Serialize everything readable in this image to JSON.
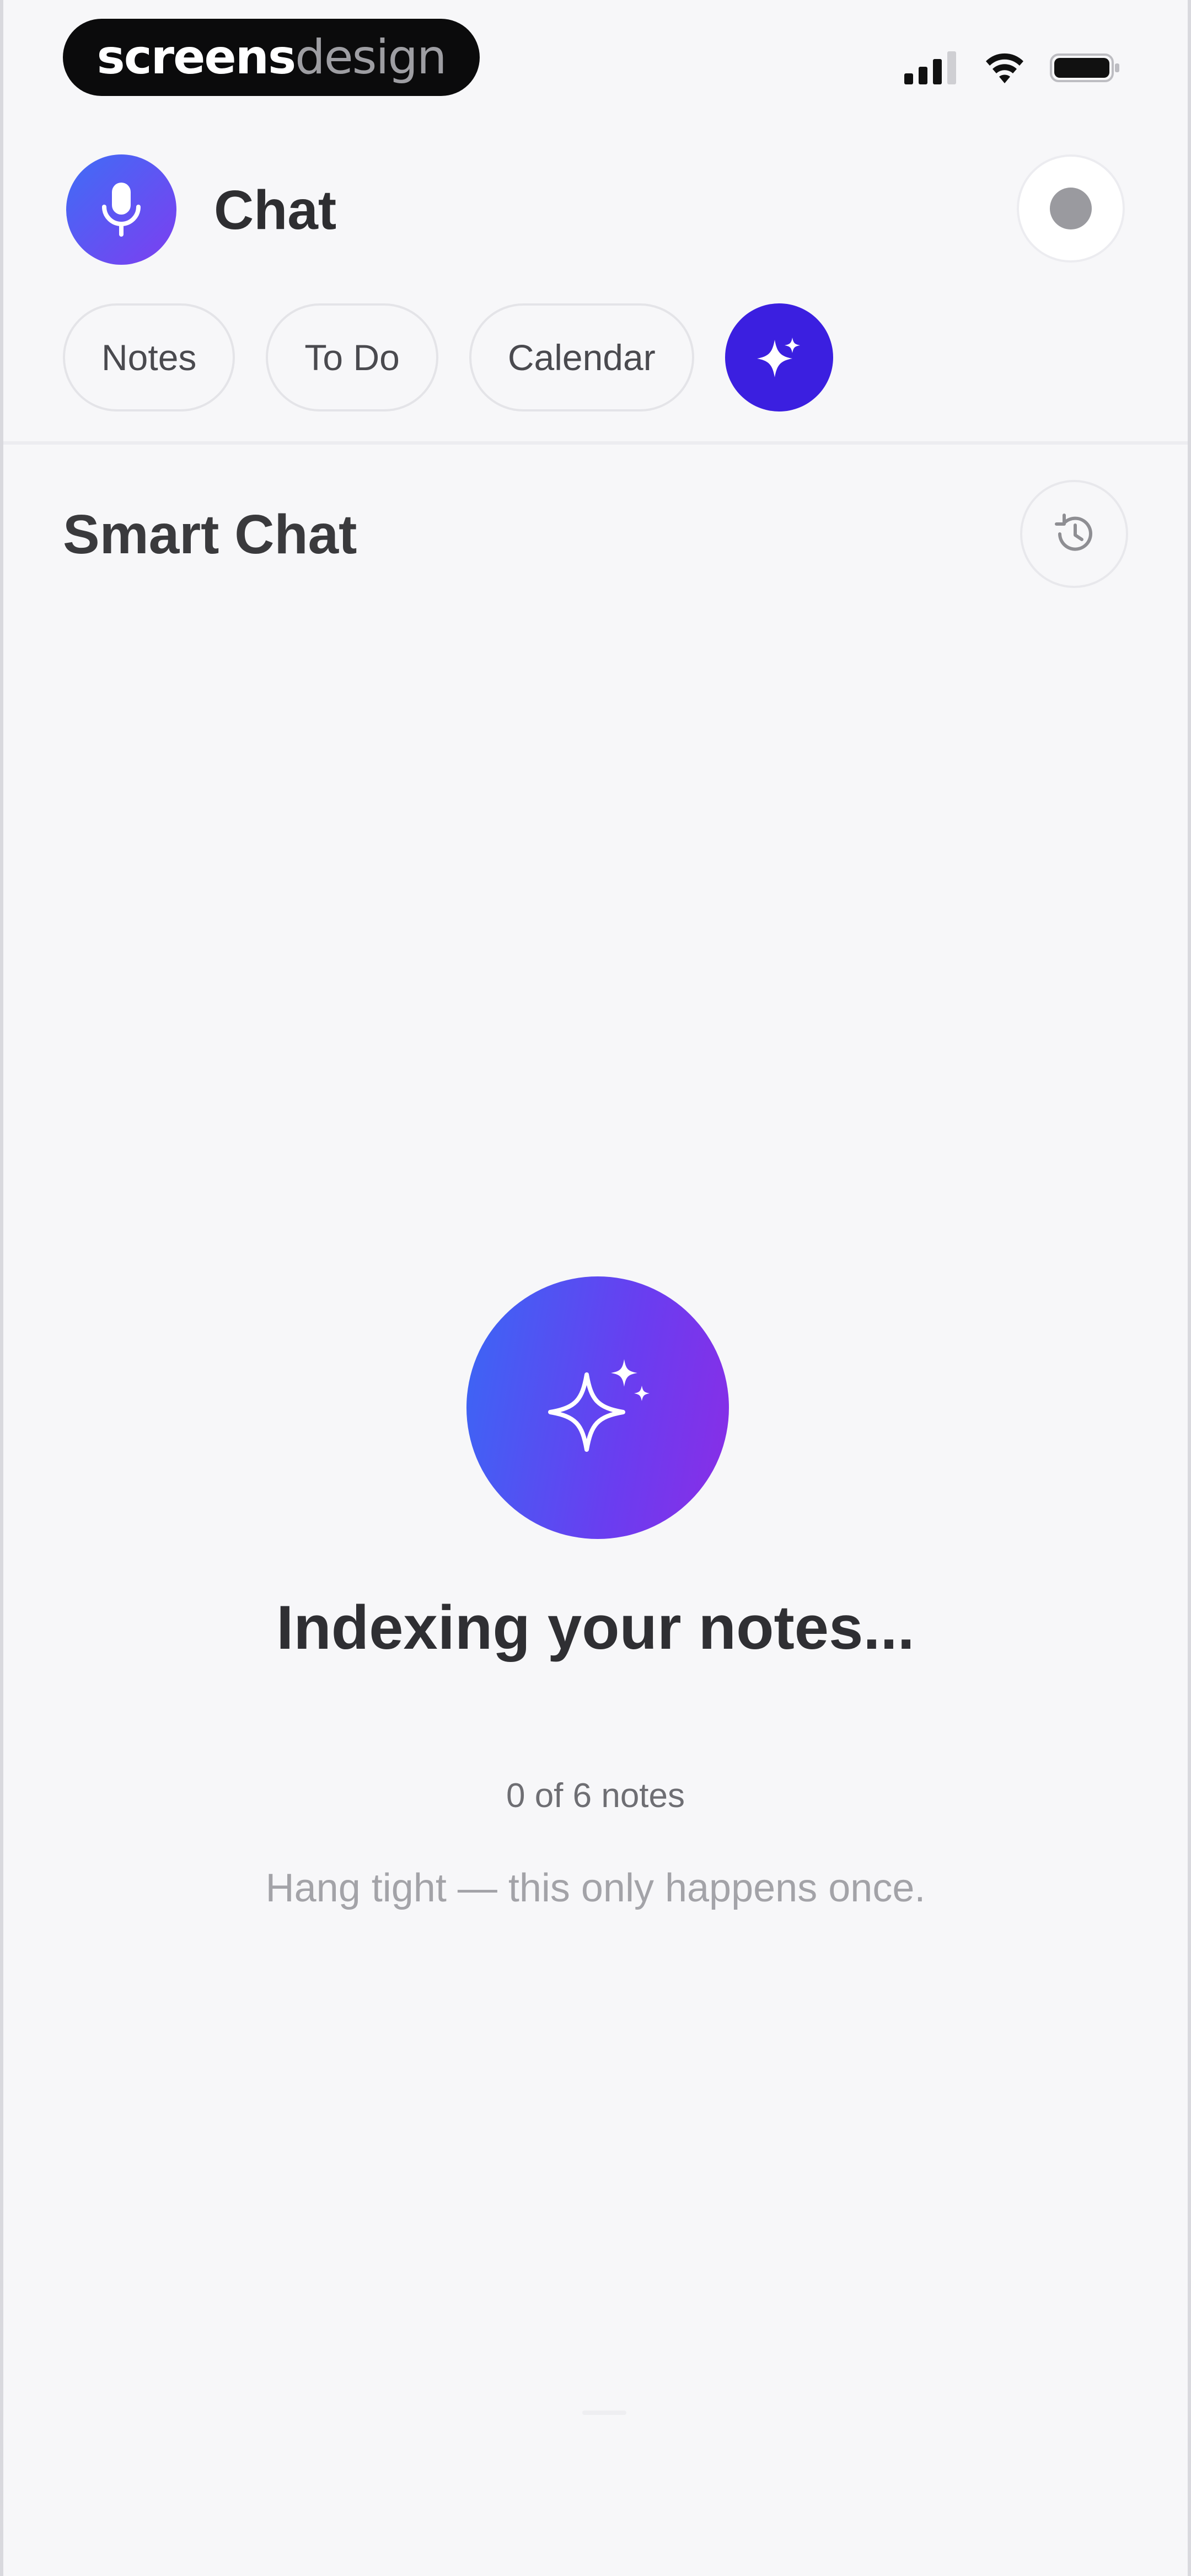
{
  "status_bar": {
    "brand_strong": "screens",
    "brand_light": "design",
    "icons": [
      "cellular-signal-icon",
      "wifi-icon",
      "battery-icon"
    ]
  },
  "header": {
    "title": "Chat",
    "avatar_icon": "microphone-icon",
    "settings_icon": "settings-icon"
  },
  "tabs": [
    {
      "label": "Notes"
    },
    {
      "label": "To Do"
    },
    {
      "label": "Calendar"
    }
  ],
  "ai_tab_icon": "sparkle-icon",
  "section": {
    "title": "Smart Chat",
    "history_icon": "history-icon"
  },
  "indexing": {
    "title": "Indexing your notes...",
    "progress": "0 of 6 notes",
    "notes_indexed": 0,
    "notes_total": 6,
    "hint": "Hang tight — this only happens once."
  },
  "colors": {
    "background": "#f7f7f9",
    "accent": "#3b1fe0",
    "gradient_start": "#3a67f5",
    "gradient_end": "#8a2de6"
  }
}
